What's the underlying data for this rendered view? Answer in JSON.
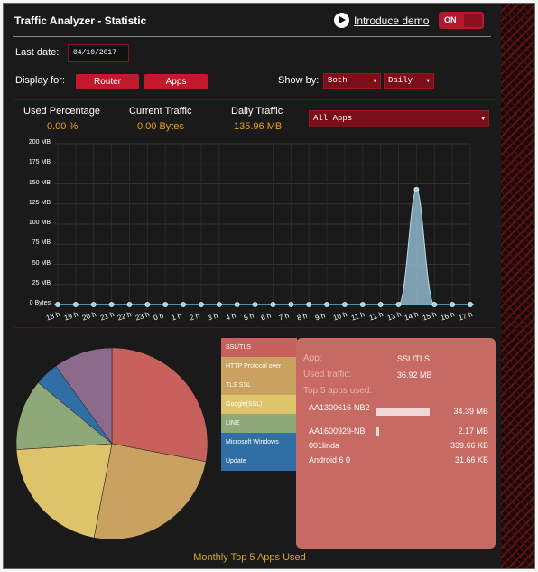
{
  "header": {
    "title": "Traffic Analyzer - Statistic",
    "intro_link": "Introduce demo",
    "toggle_label": "ON"
  },
  "controls": {
    "last_date_label": "Last date:",
    "last_date_value": "04/10/2017",
    "display_for_label": "Display for:",
    "router_button": "Router",
    "apps_button": "Apps",
    "show_by_label": "Show by:",
    "show_by_value": "Both",
    "period_value": "Daily"
  },
  "summary": {
    "used_percentage_label": "Used Percentage",
    "used_percentage_value": "0.00 %",
    "current_traffic_label": "Current Traffic",
    "current_traffic_value": "0.00 Bytes",
    "daily_traffic_label": "Daily Traffic",
    "daily_traffic_value": "135.96 MB",
    "apps_filter_value": "All Apps"
  },
  "chart_data": [
    {
      "type": "area",
      "ylim": [
        0,
        200
      ],
      "y_ticks": [
        "0 Bytes",
        "25 MB",
        "50 MB",
        "75 MB",
        "100 MB",
        "125 MB",
        "150 MB",
        "175 MB",
        "200 MB"
      ],
      "x": [
        "18 h",
        "19 h",
        "20 h",
        "21 h",
        "22 h",
        "23 h",
        "0 h",
        "1 h",
        "2 h",
        "3 h",
        "4 h",
        "5 h",
        "6 h",
        "7 h",
        "8 h",
        "9 h",
        "10 h",
        "11 h",
        "12 h",
        "13 h",
        "14 h",
        "15 h",
        "16 h",
        "17 h"
      ],
      "values": [
        0,
        0,
        0,
        0,
        0,
        0,
        0,
        0,
        0,
        0,
        0,
        0,
        0,
        0,
        0,
        0,
        0,
        0,
        0,
        0,
        143,
        0,
        0,
        0
      ],
      "colors": {
        "fill": "#8fb7cc",
        "marker": "#9ed3ee",
        "axis": "#5fb6e0"
      }
    },
    {
      "type": "pie",
      "title": "Monthly Top 5 Apps Used",
      "slices": [
        {
          "label": "SSL/TLS",
          "value": 28,
          "color": "#c8605c"
        },
        {
          "label": "HTTP Protocol over TLS SSL",
          "value": 25,
          "color": "#c9a261"
        },
        {
          "label": "Google(SSL)",
          "value": 21,
          "color": "#ddc36a"
        },
        {
          "label": "LINE",
          "value": 12,
          "color": "#8fa877"
        },
        {
          "label": "Microsoft Windows Update",
          "value": 4,
          "color": "#2f6fa6"
        },
        {
          "label": "",
          "value": 10,
          "color": "#8c6a8c"
        }
      ]
    }
  ],
  "legend": [
    {
      "label": "SSL/TLS",
      "color": "#c8605c"
    },
    {
      "label": "HTTP Protocol over",
      "color": "#c9a261"
    },
    {
      "label": "TLS SSL",
      "color": "#c9a261"
    },
    {
      "label": "Google(SSL)",
      "color": "#ddc36a"
    },
    {
      "label": "LINE",
      "color": "#8fa877"
    },
    {
      "label": "Microsoft Windows",
      "color": "#2f6fa6"
    },
    {
      "label": "Update",
      "color": "#2f6fa6"
    }
  ],
  "tooltip": {
    "app_label": "App:",
    "app_value": "SSL/TLS",
    "used_traffic_label": "Used traffic:",
    "used_traffic_value": "36.92 MB",
    "top5_label": "Top 5 apps used:",
    "rows": [
      {
        "name": "AA1300616-NB2",
        "value": "34.39 MB",
        "fraction": 0.93
      },
      {
        "name": "AA1600929-NB",
        "value": "2.17 MB",
        "fraction": 0.06
      },
      {
        "name": "001linda",
        "value": "339.66 KB",
        "fraction": 0.01
      },
      {
        "name": "Android 6 0",
        "value": "31.66 KB",
        "fraction": 0.001
      }
    ]
  }
}
